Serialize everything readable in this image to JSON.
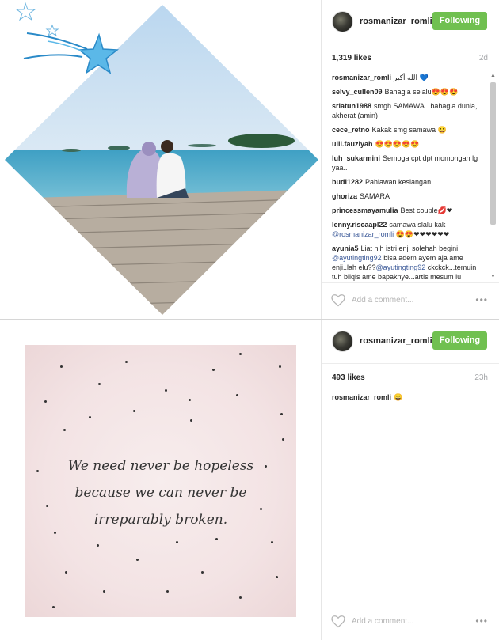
{
  "posts": [
    {
      "username": "rosmanizar_romli",
      "follow_label": "Following",
      "likes": "1,319 likes",
      "time_ago": "2d",
      "comments": [
        {
          "user": "rosmanizar_romli",
          "text": "الله أكبر 💙"
        },
        {
          "user": "selvy_cullen09",
          "text": "Bahagia selalu😍😍😍"
        },
        {
          "user": "sriatun1988",
          "text": "smgh SAMAWA.. bahagia dunia, akherat (amin)"
        },
        {
          "user": "cece_retno",
          "text": "Kakak smg samawa 😀"
        },
        {
          "user": "ulil.fauziyah",
          "text": "😍😍😍😍😍"
        },
        {
          "user": "luh_sukarmini",
          "text": "Semoga cpt dpt momongan lg yaa.."
        },
        {
          "user": "budi1282",
          "text": "Pahlawan kesiangan"
        },
        {
          "user": "ghoriza",
          "text": "SAMARA"
        },
        {
          "user": "princessmayamulia",
          "text": "Best couple💋❤"
        },
        {
          "user": "lenny.riscaapl22",
          "text": "samawa slalu kak",
          "mention": "@rosmanizar_romli",
          "after": "😍😍❤❤❤❤❤❤"
        },
        {
          "user": "ayunia5",
          "text": "Liat nih istri enji solehah begini",
          "mention": "@ayutingting92",
          "after": "bisa adem ayem aja ame enji..lah elu??",
          "mention2": "@ayutingting92",
          "after2": "ckckck...temuin tuh bilqis ame bapaknye...artis mesum lu"
        }
      ],
      "add_comment_placeholder": "Add a comment...",
      "more_label": "•••"
    },
    {
      "username": "rosmanizar_romli",
      "follow_label": "Following",
      "likes": "493 likes",
      "time_ago": "23h",
      "comments": [
        {
          "user": "rosmanizar_romli",
          "text": "😀"
        }
      ],
      "add_comment_placeholder": "Add a comment...",
      "more_label": "•••",
      "quote_lines": [
        "We need never be hopeless",
        "because we can never be",
        "irreparably broken."
      ]
    }
  ],
  "colors": {
    "follow_button": "#70c050",
    "mention": "#3b5998",
    "sky": "#cfe3f2",
    "sea": "#5fb4d0"
  },
  "icons": [
    "heart-icon",
    "star-icon",
    "more-options-icon",
    "scroll-up-icon",
    "scroll-down-icon"
  ]
}
